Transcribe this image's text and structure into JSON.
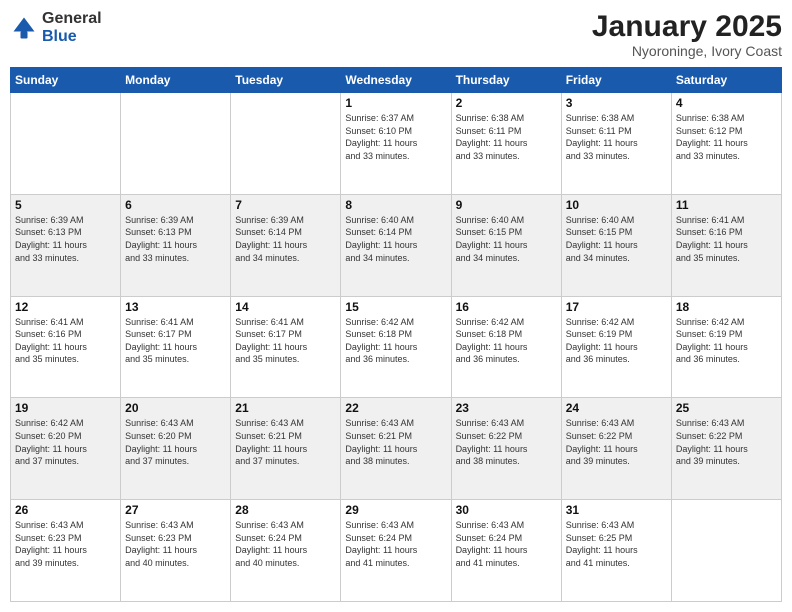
{
  "header": {
    "logo_general": "General",
    "logo_blue": "Blue",
    "title": "January 2025",
    "subtitle": "Nyoroninge, Ivory Coast"
  },
  "days_of_week": [
    "Sunday",
    "Monday",
    "Tuesday",
    "Wednesday",
    "Thursday",
    "Friday",
    "Saturday"
  ],
  "weeks": [
    {
      "shade": false,
      "days": [
        {
          "num": "",
          "info": ""
        },
        {
          "num": "",
          "info": ""
        },
        {
          "num": "",
          "info": ""
        },
        {
          "num": "1",
          "info": "Sunrise: 6:37 AM\nSunset: 6:10 PM\nDaylight: 11 hours\nand 33 minutes."
        },
        {
          "num": "2",
          "info": "Sunrise: 6:38 AM\nSunset: 6:11 PM\nDaylight: 11 hours\nand 33 minutes."
        },
        {
          "num": "3",
          "info": "Sunrise: 6:38 AM\nSunset: 6:11 PM\nDaylight: 11 hours\nand 33 minutes."
        },
        {
          "num": "4",
          "info": "Sunrise: 6:38 AM\nSunset: 6:12 PM\nDaylight: 11 hours\nand 33 minutes."
        }
      ]
    },
    {
      "shade": true,
      "days": [
        {
          "num": "5",
          "info": "Sunrise: 6:39 AM\nSunset: 6:13 PM\nDaylight: 11 hours\nand 33 minutes."
        },
        {
          "num": "6",
          "info": "Sunrise: 6:39 AM\nSunset: 6:13 PM\nDaylight: 11 hours\nand 33 minutes."
        },
        {
          "num": "7",
          "info": "Sunrise: 6:39 AM\nSunset: 6:14 PM\nDaylight: 11 hours\nand 34 minutes."
        },
        {
          "num": "8",
          "info": "Sunrise: 6:40 AM\nSunset: 6:14 PM\nDaylight: 11 hours\nand 34 minutes."
        },
        {
          "num": "9",
          "info": "Sunrise: 6:40 AM\nSunset: 6:15 PM\nDaylight: 11 hours\nand 34 minutes."
        },
        {
          "num": "10",
          "info": "Sunrise: 6:40 AM\nSunset: 6:15 PM\nDaylight: 11 hours\nand 34 minutes."
        },
        {
          "num": "11",
          "info": "Sunrise: 6:41 AM\nSunset: 6:16 PM\nDaylight: 11 hours\nand 35 minutes."
        }
      ]
    },
    {
      "shade": false,
      "days": [
        {
          "num": "12",
          "info": "Sunrise: 6:41 AM\nSunset: 6:16 PM\nDaylight: 11 hours\nand 35 minutes."
        },
        {
          "num": "13",
          "info": "Sunrise: 6:41 AM\nSunset: 6:17 PM\nDaylight: 11 hours\nand 35 minutes."
        },
        {
          "num": "14",
          "info": "Sunrise: 6:41 AM\nSunset: 6:17 PM\nDaylight: 11 hours\nand 35 minutes."
        },
        {
          "num": "15",
          "info": "Sunrise: 6:42 AM\nSunset: 6:18 PM\nDaylight: 11 hours\nand 36 minutes."
        },
        {
          "num": "16",
          "info": "Sunrise: 6:42 AM\nSunset: 6:18 PM\nDaylight: 11 hours\nand 36 minutes."
        },
        {
          "num": "17",
          "info": "Sunrise: 6:42 AM\nSunset: 6:19 PM\nDaylight: 11 hours\nand 36 minutes."
        },
        {
          "num": "18",
          "info": "Sunrise: 6:42 AM\nSunset: 6:19 PM\nDaylight: 11 hours\nand 36 minutes."
        }
      ]
    },
    {
      "shade": true,
      "days": [
        {
          "num": "19",
          "info": "Sunrise: 6:42 AM\nSunset: 6:20 PM\nDaylight: 11 hours\nand 37 minutes."
        },
        {
          "num": "20",
          "info": "Sunrise: 6:43 AM\nSunset: 6:20 PM\nDaylight: 11 hours\nand 37 minutes."
        },
        {
          "num": "21",
          "info": "Sunrise: 6:43 AM\nSunset: 6:21 PM\nDaylight: 11 hours\nand 37 minutes."
        },
        {
          "num": "22",
          "info": "Sunrise: 6:43 AM\nSunset: 6:21 PM\nDaylight: 11 hours\nand 38 minutes."
        },
        {
          "num": "23",
          "info": "Sunrise: 6:43 AM\nSunset: 6:22 PM\nDaylight: 11 hours\nand 38 minutes."
        },
        {
          "num": "24",
          "info": "Sunrise: 6:43 AM\nSunset: 6:22 PM\nDaylight: 11 hours\nand 39 minutes."
        },
        {
          "num": "25",
          "info": "Sunrise: 6:43 AM\nSunset: 6:22 PM\nDaylight: 11 hours\nand 39 minutes."
        }
      ]
    },
    {
      "shade": false,
      "days": [
        {
          "num": "26",
          "info": "Sunrise: 6:43 AM\nSunset: 6:23 PM\nDaylight: 11 hours\nand 39 minutes."
        },
        {
          "num": "27",
          "info": "Sunrise: 6:43 AM\nSunset: 6:23 PM\nDaylight: 11 hours\nand 40 minutes."
        },
        {
          "num": "28",
          "info": "Sunrise: 6:43 AM\nSunset: 6:24 PM\nDaylight: 11 hours\nand 40 minutes."
        },
        {
          "num": "29",
          "info": "Sunrise: 6:43 AM\nSunset: 6:24 PM\nDaylight: 11 hours\nand 41 minutes."
        },
        {
          "num": "30",
          "info": "Sunrise: 6:43 AM\nSunset: 6:24 PM\nDaylight: 11 hours\nand 41 minutes."
        },
        {
          "num": "31",
          "info": "Sunrise: 6:43 AM\nSunset: 6:25 PM\nDaylight: 11 hours\nand 41 minutes."
        },
        {
          "num": "",
          "info": ""
        }
      ]
    }
  ]
}
